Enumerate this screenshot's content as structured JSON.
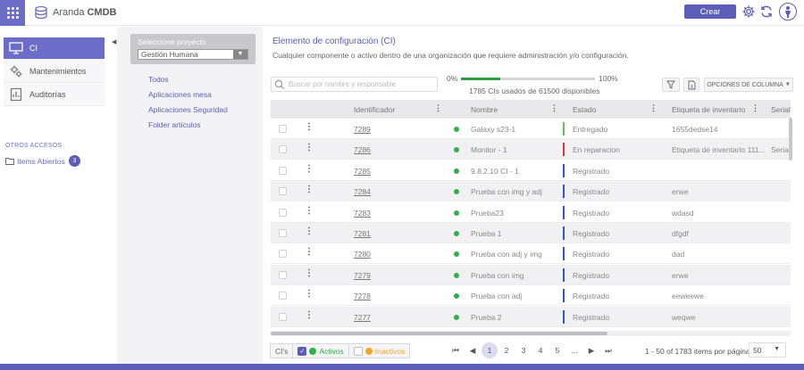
{
  "brand": {
    "name": "Aranda",
    "product": "CMDB"
  },
  "header": {
    "create_label": "Crear"
  },
  "sidebar": {
    "items": [
      {
        "label": "CI",
        "icon": "monitor-icon"
      },
      {
        "label": "Mantenimientos",
        "icon": "gears-icon"
      },
      {
        "label": "Auditorías",
        "icon": "report-icon"
      }
    ],
    "otros_title": "OTROS ACCESOS",
    "otros_item": {
      "label": "Items Abiertos",
      "count": "3"
    }
  },
  "project": {
    "select_label": "Seleccione proyecto",
    "selected": "Gestión Humana",
    "folders": [
      "Todos",
      "Aplicaciones mesa",
      "Aplicaciones Seguridad",
      "Folder artículos"
    ]
  },
  "main": {
    "title": "Elemento de configuración (CI)",
    "subtitle": "Cualquier componente o activo dentro de una organización que requiere administración y/o configuración.",
    "search_placeholder": "Buscar por nombre y responsable",
    "usage": {
      "min": "0%",
      "max": "100%",
      "text": "1785 CIs usados de 61500 disponibles",
      "fraction": 0.029
    },
    "column_options": "OPCIONES DE COLUMNA"
  },
  "table": {
    "columns": [
      "Identificador",
      "Nombre",
      "Estado",
      "Etiqueta de inventario",
      "Serial"
    ],
    "rows": [
      {
        "id": "7289",
        "name": "Galaxy s23-1",
        "state": "Entregado",
        "state_color": "#5cc45c",
        "tag": "1655dedse14",
        "serial": ""
      },
      {
        "id": "7286",
        "name": "Monitor - 1",
        "state": "En reparacion",
        "state_color": "#d9363e",
        "tag": "Etiqueta de inventario 111...",
        "serial": "Serial"
      },
      {
        "id": "7285",
        "name": "9.8.2.10 CI - 1",
        "state": "Registrado",
        "state_color": "#2f55d4",
        "tag": "",
        "serial": ""
      },
      {
        "id": "7284",
        "name": "Prueba con img y adj",
        "state": "Registrado",
        "state_color": "#2f55d4",
        "tag": "erwe",
        "serial": ""
      },
      {
        "id": "7283",
        "name": "Prueba23",
        "state": "Registrado",
        "state_color": "#2f55d4",
        "tag": "wdasd",
        "serial": ""
      },
      {
        "id": "7281",
        "name": "Prueba 1",
        "state": "Registrado",
        "state_color": "#2f55d4",
        "tag": "dfgdf",
        "serial": ""
      },
      {
        "id": "7280",
        "name": "Prueba con adj y img",
        "state": "Registrado",
        "state_color": "#2f55d4",
        "tag": "dad",
        "serial": ""
      },
      {
        "id": "7279",
        "name": "Prueba con img",
        "state": "Registrado",
        "state_color": "#2f55d4",
        "tag": "erwe",
        "serial": ""
      },
      {
        "id": "7278",
        "name": "Prueba con adj",
        "state": "Registrado",
        "state_color": "#2f55d4",
        "tag": "eeweewe",
        "serial": ""
      },
      {
        "id": "7277",
        "name": "Prueba 2",
        "state": "Registrado",
        "state_color": "#2f55d4",
        "tag": "weqwe",
        "serial": ""
      }
    ]
  },
  "footer": {
    "chip_cis": "CI's",
    "chip_activos": "Activos",
    "chip_inactivos": "Inactivos",
    "activos_color": "#2db24a",
    "inactivos_color": "#f5a623",
    "pages": [
      "1",
      "2",
      "3",
      "4",
      "5",
      "..."
    ],
    "current_page": "1",
    "info": "1 - 50 of 1783 items por página",
    "page_size": "50"
  }
}
